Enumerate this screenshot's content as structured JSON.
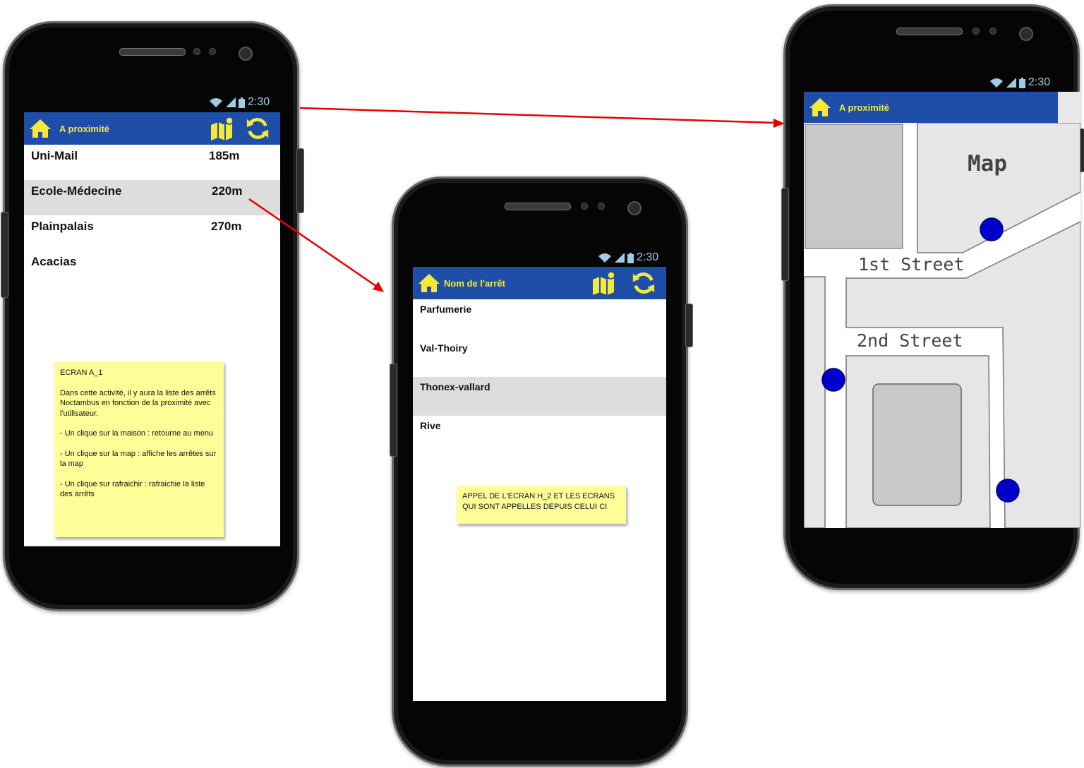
{
  "status": {
    "time": "2:30"
  },
  "screen_a": {
    "title": "A proximité",
    "icons": {
      "home": "home-icon",
      "map": "map-icon",
      "refresh": "refresh-icon"
    },
    "stops": [
      {
        "name": "Uni-Mail",
        "distance": "185m"
      },
      {
        "name": "Ecole-Médecine",
        "distance": "220m",
        "selected": true
      },
      {
        "name": "Plainpalais",
        "distance": "270m"
      },
      {
        "name": "Acacias",
        "distance": ""
      }
    ],
    "note": {
      "title": "ECRAN A_1",
      "lines": [
        "Dans cette activité, il y aura la liste des arrêts Noctambus en fonction de la proximité avec l'utilisateur.",
        "- Un clique sur la maison : retourne au menu",
        "- Un clique sur la map : affiche les arrêtes sur la map",
        "- Un clique sur rafraichir : rafraichie la liste des arrêts"
      ]
    }
  },
  "screen_b": {
    "title": "Nom de l'arrêt",
    "stops": [
      {
        "name": "Parfumerie"
      },
      {
        "name": "Val-Thoiry"
      },
      {
        "name": "Thonex-vallard",
        "selected": true
      },
      {
        "name": "Rive"
      }
    ],
    "note": "APPEL DE L'ECRAN H_2 ET LES ECRANS QUI SONT APPELLES DEPUIS CELUI CI"
  },
  "screen_c": {
    "title": "A proximité",
    "map": {
      "title": "Map",
      "street1": "1st Street",
      "street2": "2nd Street"
    }
  },
  "colors": {
    "appbar": "#1f4ea8",
    "appbar_text": "#f5e83a",
    "selected_row": "#dddddd",
    "note": "#ffff99",
    "arrow": "#e60000",
    "map_marker": "#0000cc"
  }
}
